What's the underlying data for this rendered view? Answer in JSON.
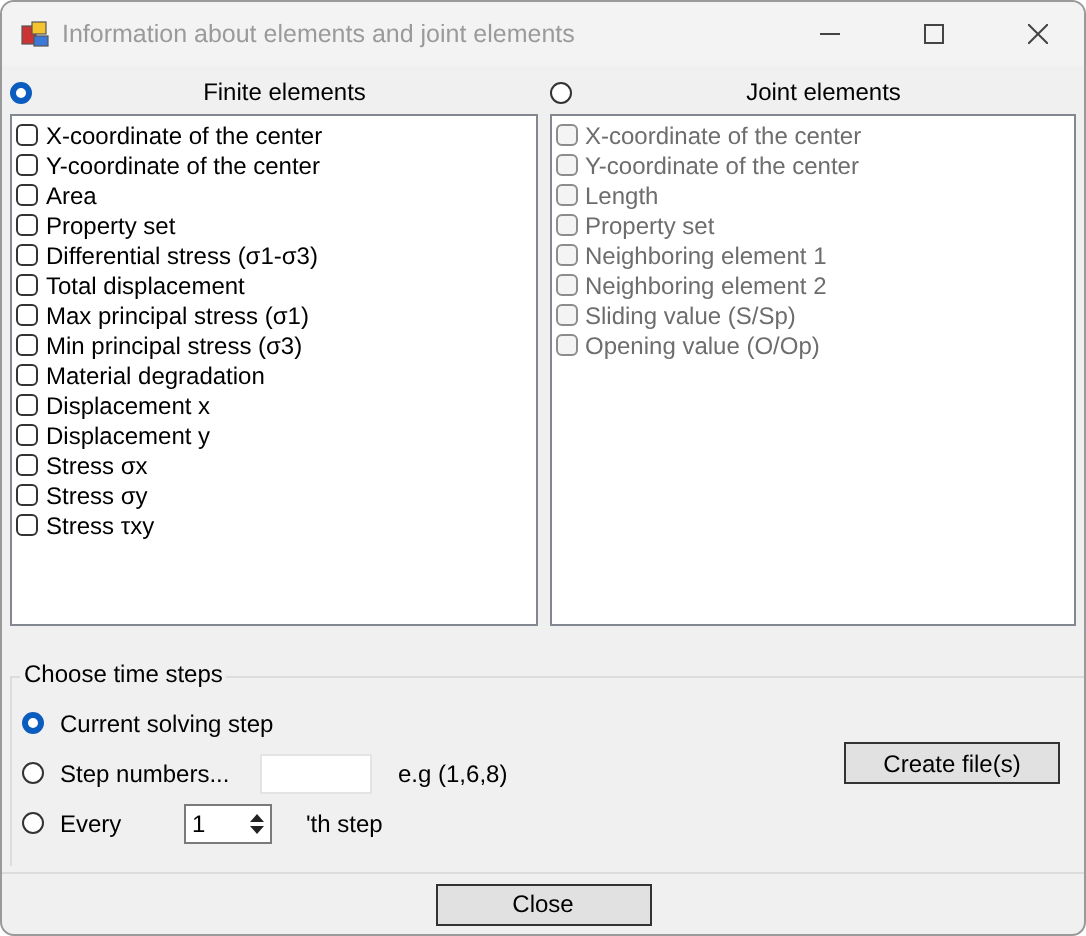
{
  "window": {
    "title": "Information about elements and joint elements"
  },
  "panels": [
    {
      "label": "Finite elements",
      "selected": true,
      "disabled": false,
      "items": [
        {
          "label": "X-coordinate of the center",
          "checked": false
        },
        {
          "label": "Y-coordinate of the center",
          "checked": false
        },
        {
          "label": "Area",
          "checked": false
        },
        {
          "label": "Property set",
          "checked": false
        },
        {
          "label": "Differential stress (σ1-σ3)",
          "checked": false
        },
        {
          "label": "Total displacement",
          "checked": false
        },
        {
          "label": "Max principal stress (σ1)",
          "checked": false
        },
        {
          "label": "Min principal stress (σ3)",
          "checked": false
        },
        {
          "label": "Material degradation",
          "checked": false
        },
        {
          "label": "Displacement x",
          "checked": false
        },
        {
          "label": "Displacement y",
          "checked": false
        },
        {
          "label": "Stress σx",
          "checked": false
        },
        {
          "label": "Stress σy",
          "checked": false
        },
        {
          "label": "Stress τxy",
          "checked": false
        }
      ]
    },
    {
      "label": "Joint elements",
      "selected": false,
      "disabled": true,
      "items": [
        {
          "label": "X-coordinate of the center",
          "checked": false
        },
        {
          "label": "Y-coordinate of the center",
          "checked": false
        },
        {
          "label": "Length",
          "checked": false
        },
        {
          "label": "Property set",
          "checked": false
        },
        {
          "label": "Neighboring element 1",
          "checked": false
        },
        {
          "label": "Neighboring element 2",
          "checked": false
        },
        {
          "label": "Sliding value (S/Sp)",
          "checked": false
        },
        {
          "label": "Opening value (O/Op)",
          "checked": false
        }
      ]
    }
  ],
  "time_steps": {
    "title": "Choose time steps",
    "options": [
      {
        "kind": "plain",
        "label": "Current solving step",
        "selected": true
      },
      {
        "kind": "text",
        "label": "Step numbers...",
        "hint": "e.g (1,6,8)",
        "selected": false
      },
      {
        "kind": "spin",
        "label": "Every",
        "value": "1",
        "suffix": "'th step",
        "selected": false
      }
    ],
    "button": "Create file(s)"
  },
  "buttons": [
    "Close"
  ]
}
